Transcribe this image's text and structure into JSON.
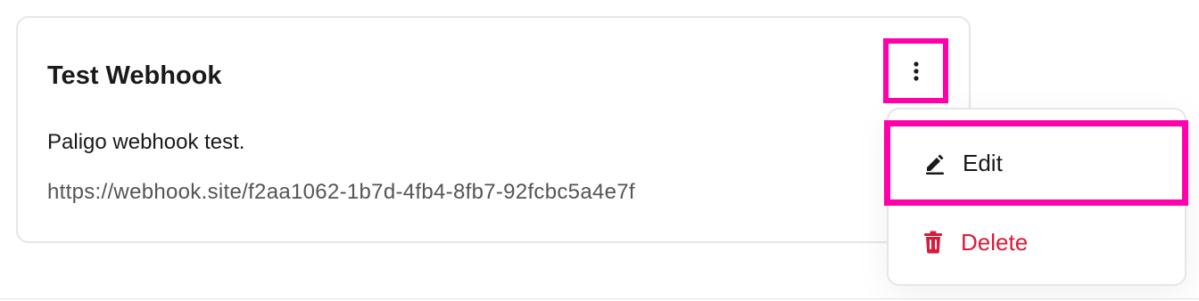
{
  "card": {
    "title": "Test Webhook",
    "description": "Paligo webhook test.",
    "url": "https://webhook.site/f2aa1062-1b7d-4fb4-8fb7-92fcbc5a4e7f"
  },
  "more_button": {
    "icon": "more-vertical-icon"
  },
  "menu": {
    "items": [
      {
        "label": "Edit",
        "icon": "pencil-icon",
        "color": "#1a1a1a"
      },
      {
        "label": "Delete",
        "icon": "trash-icon",
        "color": "#d81b3b"
      }
    ]
  },
  "colors": {
    "highlight": "#ff00aa",
    "danger": "#d81b3b",
    "border": "#e6e6e6",
    "text": "#1a1a1a",
    "muted": "#555555"
  }
}
